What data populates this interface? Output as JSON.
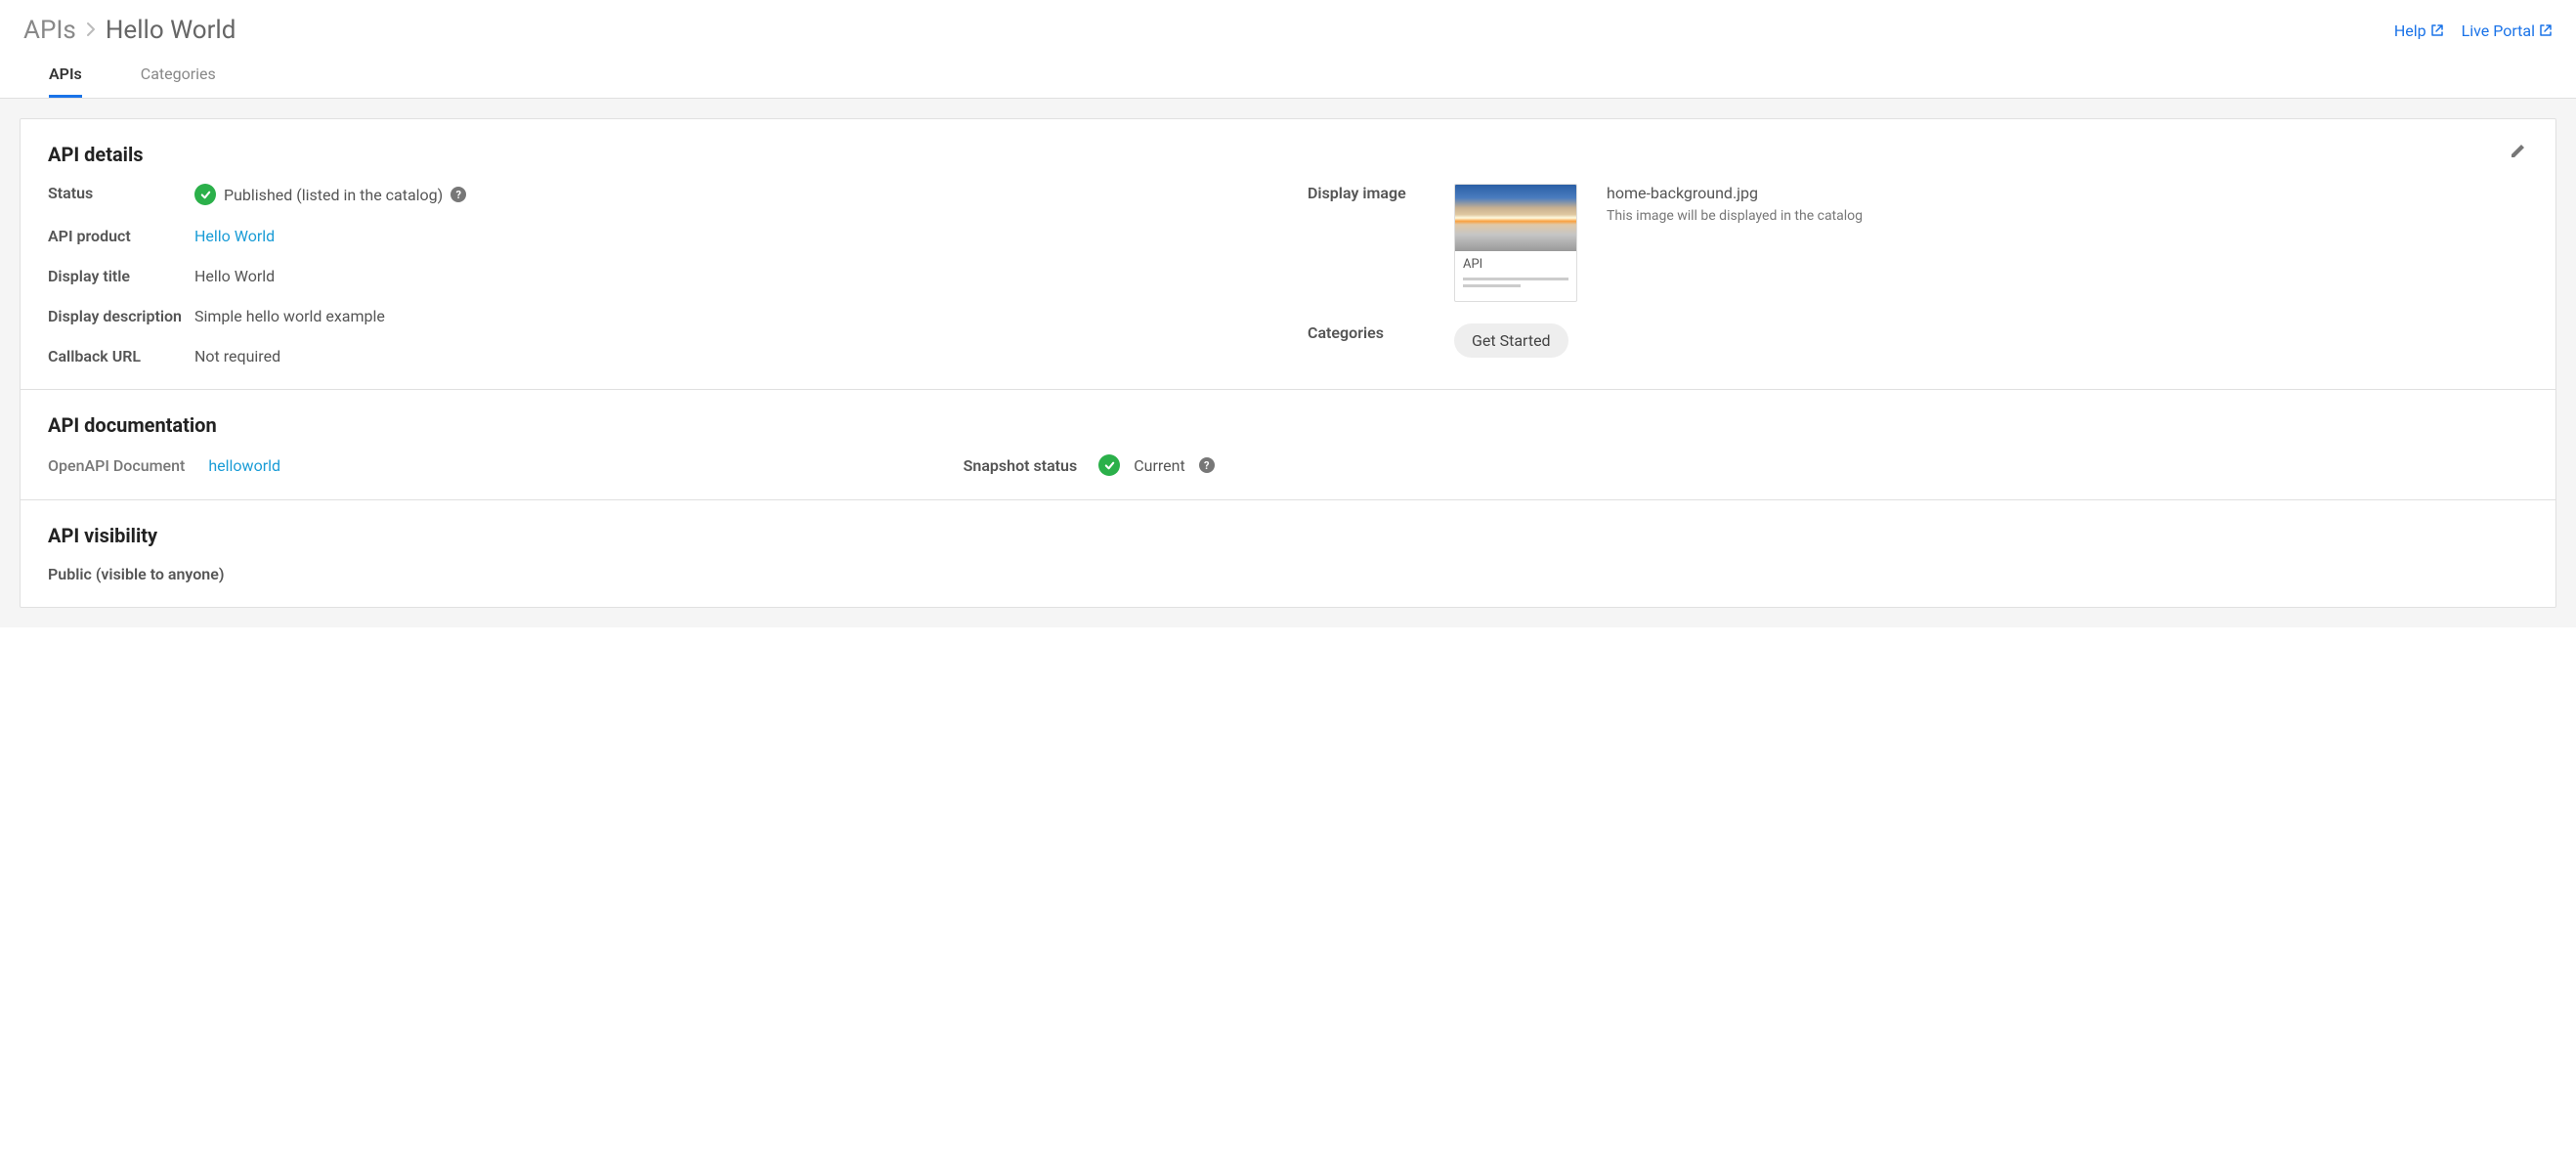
{
  "breadcrumb": {
    "root": "APIs",
    "current": "Hello World"
  },
  "header_links": {
    "help": "Help",
    "live_portal": "Live Portal"
  },
  "tabs": {
    "apis": "APIs",
    "categories": "Categories"
  },
  "details": {
    "title": "API details",
    "status_label": "Status",
    "status_value": "Published (listed in the catalog)",
    "api_product_label": "API product",
    "api_product_value": "Hello World",
    "display_title_label": "Display title",
    "display_title_value": "Hello World",
    "display_description_label": "Display description",
    "display_description_value": "Simple hello world example",
    "callback_url_label": "Callback URL",
    "callback_url_value": "Not required",
    "display_image_label": "Display image",
    "display_image_filename": "home-background.jpg",
    "display_image_desc": "This image will be displayed in the catalog",
    "display_image_preview_text": "API",
    "categories_label": "Categories",
    "categories_chip": "Get Started"
  },
  "documentation": {
    "title": "API documentation",
    "doc_label": "OpenAPI Document",
    "doc_value": "helloworld",
    "snapshot_label": "Snapshot status",
    "snapshot_value": "Current"
  },
  "visibility": {
    "title": "API visibility",
    "value": "Public (visible to anyone)"
  }
}
